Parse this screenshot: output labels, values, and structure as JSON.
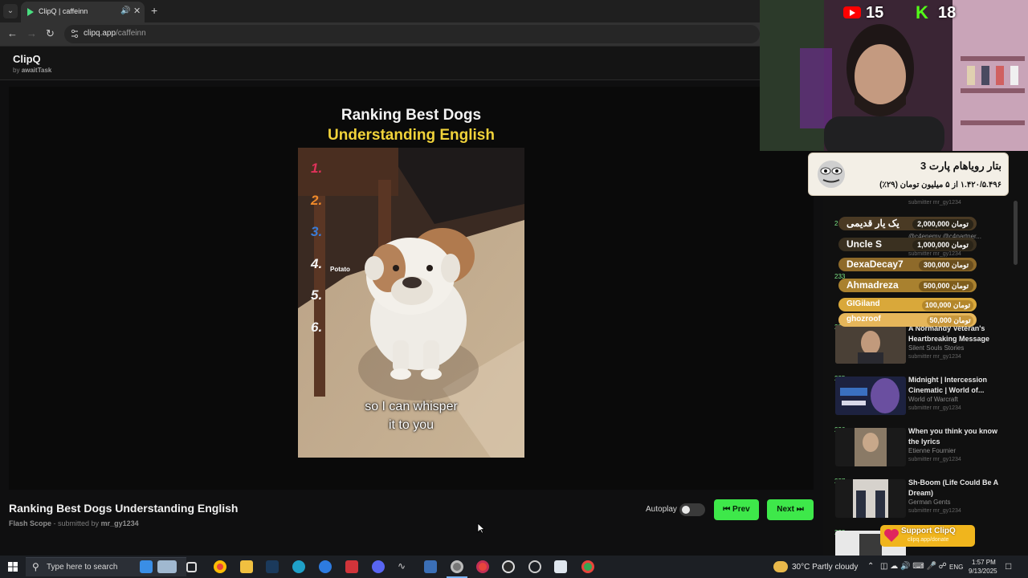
{
  "browser": {
    "tab_title": "ClipQ | caffeinn",
    "url_host": "clipq.app",
    "url_path": "/caffeinn"
  },
  "app": {
    "brand": "ClipQ",
    "by_prefix": "by",
    "by_author": "awaitTask"
  },
  "video": {
    "heading_line1": "Ranking Best Dogs",
    "heading_line2": "Understanding English",
    "ranks": [
      "1.",
      "2.",
      "3.",
      "4.",
      "5.",
      "6."
    ],
    "rank4_label": "Potato",
    "caption_line1": "so I can whisper",
    "caption_line2": "it to you"
  },
  "clip": {
    "title": "Ranking Best Dogs Understanding English",
    "channel": "Flash Scope",
    "submitted_prefix": "- submitted by",
    "submitter": "mr_gy1234",
    "autoplay_label": "Autoplay",
    "autoplay_on": false,
    "prev_label": "Prev",
    "next_label": "Next"
  },
  "queue": [
    {
      "num": "234",
      "title": "A Normandy Veteran's Heartbreaking Message",
      "channel": "Silent Souls Stories",
      "submitter": "submitter mr_gy1234"
    },
    {
      "num": "235",
      "title": "Midnight | Intercession Cinematic | World of...",
      "channel": "World of Warcraft",
      "submitter": "submitter mr_gy1234"
    },
    {
      "num": "236",
      "title": "When you think you know the lyrics",
      "channel": "Etienne Fournier",
      "submitter": "submitter mr_gy1234"
    },
    {
      "num": "237",
      "title": "Sh-Boom (Life Could Be A Dream)",
      "channel": "German Gents",
      "submitter": "submitter mr_gy1234"
    },
    {
      "num": "238",
      "title": "",
      "channel": "",
      "submitter": ""
    }
  ],
  "queue_partial": {
    "row1_sub": "submitter mr_gy1234",
    "row2_num": "2",
    "row2_sub": "@c4enemy @c4partner...",
    "row3_sub": "submitter mr_gy1234",
    "row4_num": "233"
  },
  "donations": {
    "banner_line1": "بتار رویاهام پارت 3",
    "banner_line2": "۱.۴۲۰/۵.۴۹۶ از ۵ میلیون تومان (۲۹٪)",
    "rows": [
      {
        "name": "یک یار قدیمی",
        "amount": "2,000,000 تومان"
      },
      {
        "name": "Uncle S",
        "amount": "1,000,000 تومان"
      },
      {
        "name": "DexaDecay7",
        "amount": "300,000 تومان"
      },
      {
        "name": "Ahmadreza",
        "amount": "500,000 تومان"
      },
      {
        "name": "GIGiland",
        "amount": "100,000 تومان"
      },
      {
        "name": "ghozroof",
        "amount": "50,000 تومان"
      }
    ]
  },
  "webcam": {
    "youtube_count": "15",
    "kick_count": "18"
  },
  "support": {
    "label": "Support ClipQ",
    "sub": "clipq.app/donate"
  },
  "taskbar": {
    "search_placeholder": "Type here to search",
    "weather": "30°C  Partly cloudy",
    "lang": "ENG",
    "time": "1:57 PM",
    "date": "9/13/2025"
  },
  "colors": {
    "accent_green": "#3ee84a",
    "heading_yellow": "#f1d33a",
    "queue_num_green": "#7ee787"
  }
}
